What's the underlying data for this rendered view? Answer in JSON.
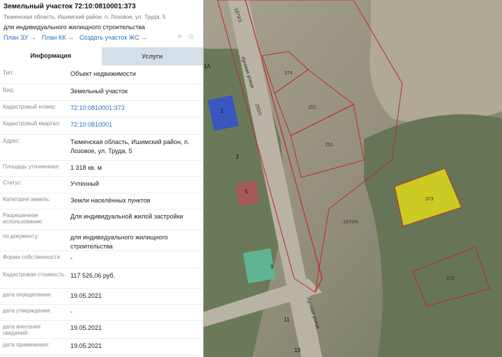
{
  "header": {
    "title": "Земельный участок 72:10:0810001:373",
    "address": "Тюменская область, Ишимский район, п. Лозовое, ул. Труда, 5",
    "purpose": "для индивидуального жилищного строительства",
    "links": [
      "План ЗУ →",
      "План КК →",
      "Создать участок ЖС →"
    ]
  },
  "tabs": [
    "Информация",
    "Услуги"
  ],
  "rows": [
    {
      "label": "Тип:",
      "value": "Объект недвижимости"
    },
    {
      "label": "Вид:",
      "value": "Земельный участок"
    },
    {
      "label": "Кадастровый номер:",
      "value": "72:10:0810001:373",
      "link": true
    },
    {
      "label": "Кадастровый квартал:",
      "value": "72:10:0810001",
      "link": true
    },
    {
      "label": "Адрес:",
      "value": "Тюменская область, Ишимский район, п. Лозовое, ул. Труда, 5"
    },
    {
      "label": "Площадь уточненная:",
      "value": "1 318 кв. м"
    },
    {
      "label": "Статус:",
      "value": "Учтенный"
    },
    {
      "label": "Категория земель:",
      "value": "Земли населённых пунктов"
    },
    {
      "label": "Разрешенное использование:",
      "value": "Для индивидуальной жилой застройки"
    },
    {
      "label": "по документу:",
      "value": "для индивидуального жилищного строительства"
    },
    {
      "label": "Форма собственности:",
      "value": "-"
    },
    {
      "label": "Кадастровая стоимость:",
      "value": "117 526,06 руб."
    },
    {
      "label": "дата определения:",
      "value": "19.05.2021"
    },
    {
      "label": "дата утверждения:",
      "value": "-"
    },
    {
      "label": "дата внесения сведений:",
      "value": "19.05.2021"
    },
    {
      "label": "дата применения:",
      "value": "19.05.2021"
    }
  ],
  "map": {
    "parcel_labels": [
      "374",
      "251",
      "252",
      "373",
      "375",
      "1879/4",
      "1879/3",
      "253/1"
    ],
    "house_numbers": [
      "1A",
      "1",
      "3",
      "5",
      "9",
      "11",
      "13"
    ],
    "street_labels": [
      "Луговая улица",
      "Луговая улица"
    ],
    "colors": {
      "parcel_border": "#c0282d",
      "selected_fill": "#d6d51e",
      "road": "#b9b3a6"
    }
  }
}
